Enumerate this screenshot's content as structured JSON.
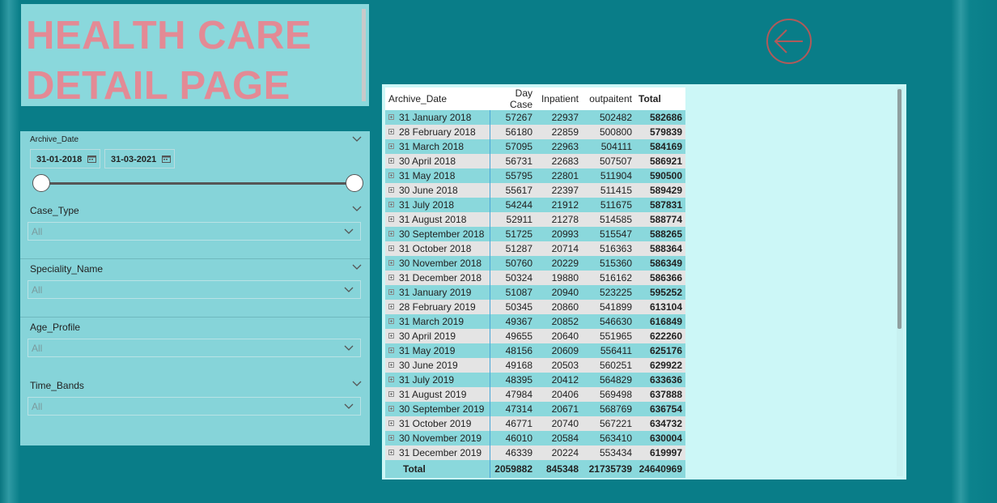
{
  "title": {
    "line1": "HEALTH CARE",
    "line2": "DETAIL PAGE"
  },
  "back_button": {
    "icon": "back-arrow-icon"
  },
  "filters": {
    "archive_date": {
      "label": "Archive_Date",
      "start": "31-01-2018",
      "end": "31-03-2021"
    },
    "case_type": {
      "label": "Case_Type",
      "value": "All"
    },
    "speciality_name": {
      "label": "Speciality_Name",
      "value": "All"
    },
    "age_profile": {
      "label": "Age_Profile",
      "value": "All"
    },
    "time_bands": {
      "label": "Time_Bands",
      "value": "All"
    }
  },
  "table": {
    "headers": [
      "Archive_Date",
      "Day Case",
      "Inpatient",
      "outpaitent",
      "Total"
    ],
    "rows": [
      [
        "31 January 2018",
        "57267",
        "22937",
        "502482",
        "582686"
      ],
      [
        "28 February 2018",
        "56180",
        "22859",
        "500800",
        "579839"
      ],
      [
        "31 March 2018",
        "57095",
        "22963",
        "504111",
        "584169"
      ],
      [
        "30 April 2018",
        "56731",
        "22683",
        "507507",
        "586921"
      ],
      [
        "31 May 2018",
        "55795",
        "22801",
        "511904",
        "590500"
      ],
      [
        "30 June 2018",
        "55617",
        "22397",
        "511415",
        "589429"
      ],
      [
        "31 July 2018",
        "54244",
        "21912",
        "511675",
        "587831"
      ],
      [
        "31 August 2018",
        "52911",
        "21278",
        "514585",
        "588774"
      ],
      [
        "30 September 2018",
        "51725",
        "20993",
        "515547",
        "588265"
      ],
      [
        "31 October 2018",
        "51287",
        "20714",
        "516363",
        "588364"
      ],
      [
        "30 November 2018",
        "50760",
        "20229",
        "515360",
        "586349"
      ],
      [
        "31 December 2018",
        "50324",
        "19880",
        "516162",
        "586366"
      ],
      [
        "31 January 2019",
        "51087",
        "20940",
        "523225",
        "595252"
      ],
      [
        "28 February 2019",
        "50345",
        "20860",
        "541899",
        "613104"
      ],
      [
        "31 March 2019",
        "49367",
        "20852",
        "546630",
        "616849"
      ],
      [
        "30 April 2019",
        "49655",
        "20640",
        "551965",
        "622260"
      ],
      [
        "31 May 2019",
        "48156",
        "20609",
        "556411",
        "625176"
      ],
      [
        "30 June 2019",
        "49168",
        "20503",
        "560251",
        "629922"
      ],
      [
        "31 July 2019",
        "48395",
        "20412",
        "564829",
        "633636"
      ],
      [
        "31 August 2019",
        "47984",
        "20406",
        "569498",
        "637888"
      ],
      [
        "30 September 2019",
        "47314",
        "20671",
        "568769",
        "636754"
      ],
      [
        "31 October 2019",
        "46771",
        "20740",
        "567221",
        "634732"
      ],
      [
        "30 November 2019",
        "46010",
        "20584",
        "563410",
        "630004"
      ],
      [
        "31 December 2019",
        "46339",
        "20224",
        "553434",
        "619997"
      ]
    ],
    "total": [
      "Total",
      "2059882",
      "845348",
      "21735739",
      "24640969"
    ]
  }
}
